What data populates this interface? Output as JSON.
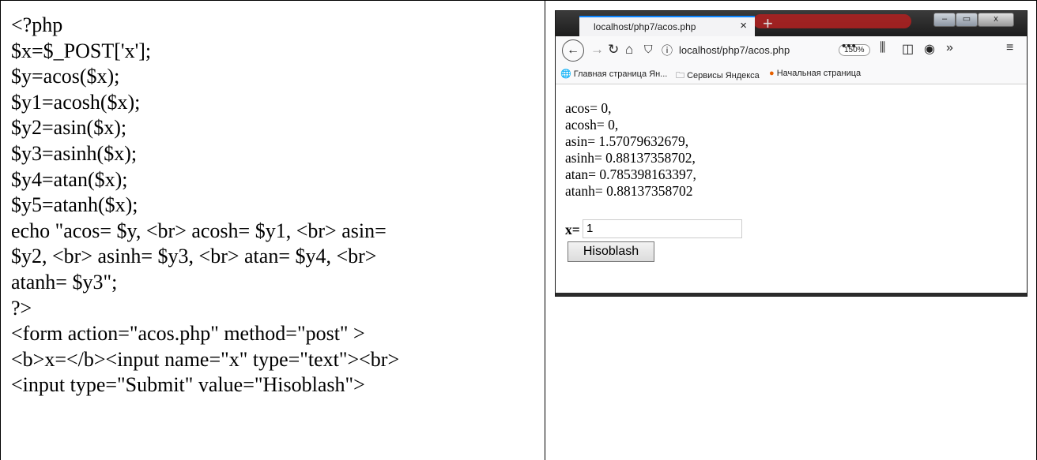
{
  "code": {
    "lines": [
      "<?php",
      "$x=$_POST['x'];",
      "$y=acos($x);",
      "$y1=acosh($x);",
      "$y2=asin($x);",
      "$y3=asinh($x);",
      "$y4=atan($x);",
      "$y5=atanh($x);",
      "echo \"acos= $y, <br> acosh= $y1, <br> asin=",
      "$y2, <br> asinh= $y3, <br> atan= $y4, <br>",
      "atanh= $y3\";",
      "?>",
      "<form action=\"acos.php\" method=\"post\" >",
      "<b>x=</b><input name=\"x\" type=\"text\"><br>",
      "<input type=\"Submit\" value=\"Hisoblash\">"
    ]
  },
  "browser": {
    "tab_title": "localhost/php7/acos.php",
    "tab_close": "×",
    "new_tab": "+",
    "window_controls": {
      "minimize": "–",
      "maximize": "▭",
      "close": "x"
    },
    "url": "localhost/php7/acos.php",
    "zoom": "150%",
    "page_actions": "•••",
    "bookmarks": [
      {
        "icon": "globe-icon",
        "label": "Главная страница Ян..."
      },
      {
        "icon": "folder-icon",
        "label": "Сервисы Яндекса"
      },
      {
        "icon": "firefox-icon",
        "label": "Начальная страница"
      }
    ],
    "output_lines": [
      "acos= 0,",
      "acosh= 0,",
      "asin= 1.57079632679,",
      "asinh= 0.88137358702,",
      "atan= 0.785398163397,",
      "atanh= 0.88137358702"
    ],
    "form_label": "x=",
    "input_value": "1",
    "submit_label": "Hisoblash"
  },
  "colors": {
    "accent": "#0a84ff",
    "glow": "#b32020"
  }
}
